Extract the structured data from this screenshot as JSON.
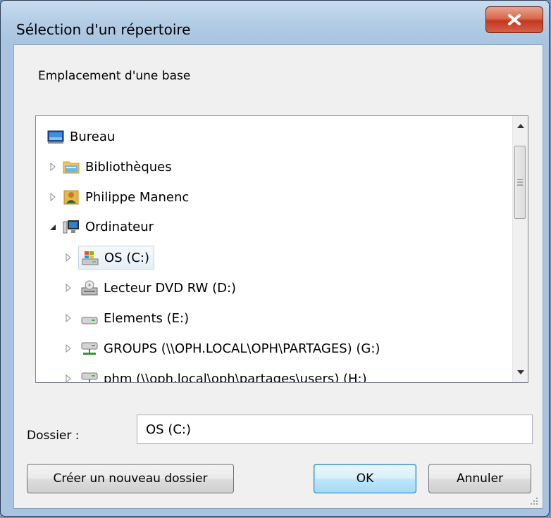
{
  "window": {
    "title": "Sélection d'un répertoire"
  },
  "prompt": "Emplacement d'une base",
  "tree": {
    "items": [
      {
        "label": "Bureau",
        "icon": "desktop-icon",
        "expander": "none"
      },
      {
        "label": "Bibliothèques",
        "icon": "libraries-icon",
        "expander": "collapsed"
      },
      {
        "label": "Philippe Manenc",
        "icon": "user-folder-icon",
        "expander": "collapsed"
      },
      {
        "label": "Ordinateur",
        "icon": "computer-icon",
        "expander": "expanded"
      },
      {
        "label": "OS (C:)",
        "icon": "system-drive-icon",
        "expander": "collapsed",
        "selected": true
      },
      {
        "label": "Lecteur DVD RW (D:)",
        "icon": "dvd-drive-icon",
        "expander": "collapsed"
      },
      {
        "label": "Elements (E:)",
        "icon": "removable-drive-icon",
        "expander": "collapsed"
      },
      {
        "label": "GROUPS (\\\\OPH.LOCAL\\OPH\\PARTAGES) (G:)",
        "icon": "network-drive-icon",
        "expander": "collapsed"
      },
      {
        "label": "phm (\\\\oph.local\\oph\\partages\\users) (H:)",
        "icon": "network-drive-icon",
        "expander": "collapsed"
      }
    ]
  },
  "folder": {
    "label": "Dossier :",
    "value": "OS (C:)"
  },
  "buttons": {
    "new_folder": "Créer un nouveau dossier",
    "ok": "OK",
    "cancel": "Annuler"
  }
}
